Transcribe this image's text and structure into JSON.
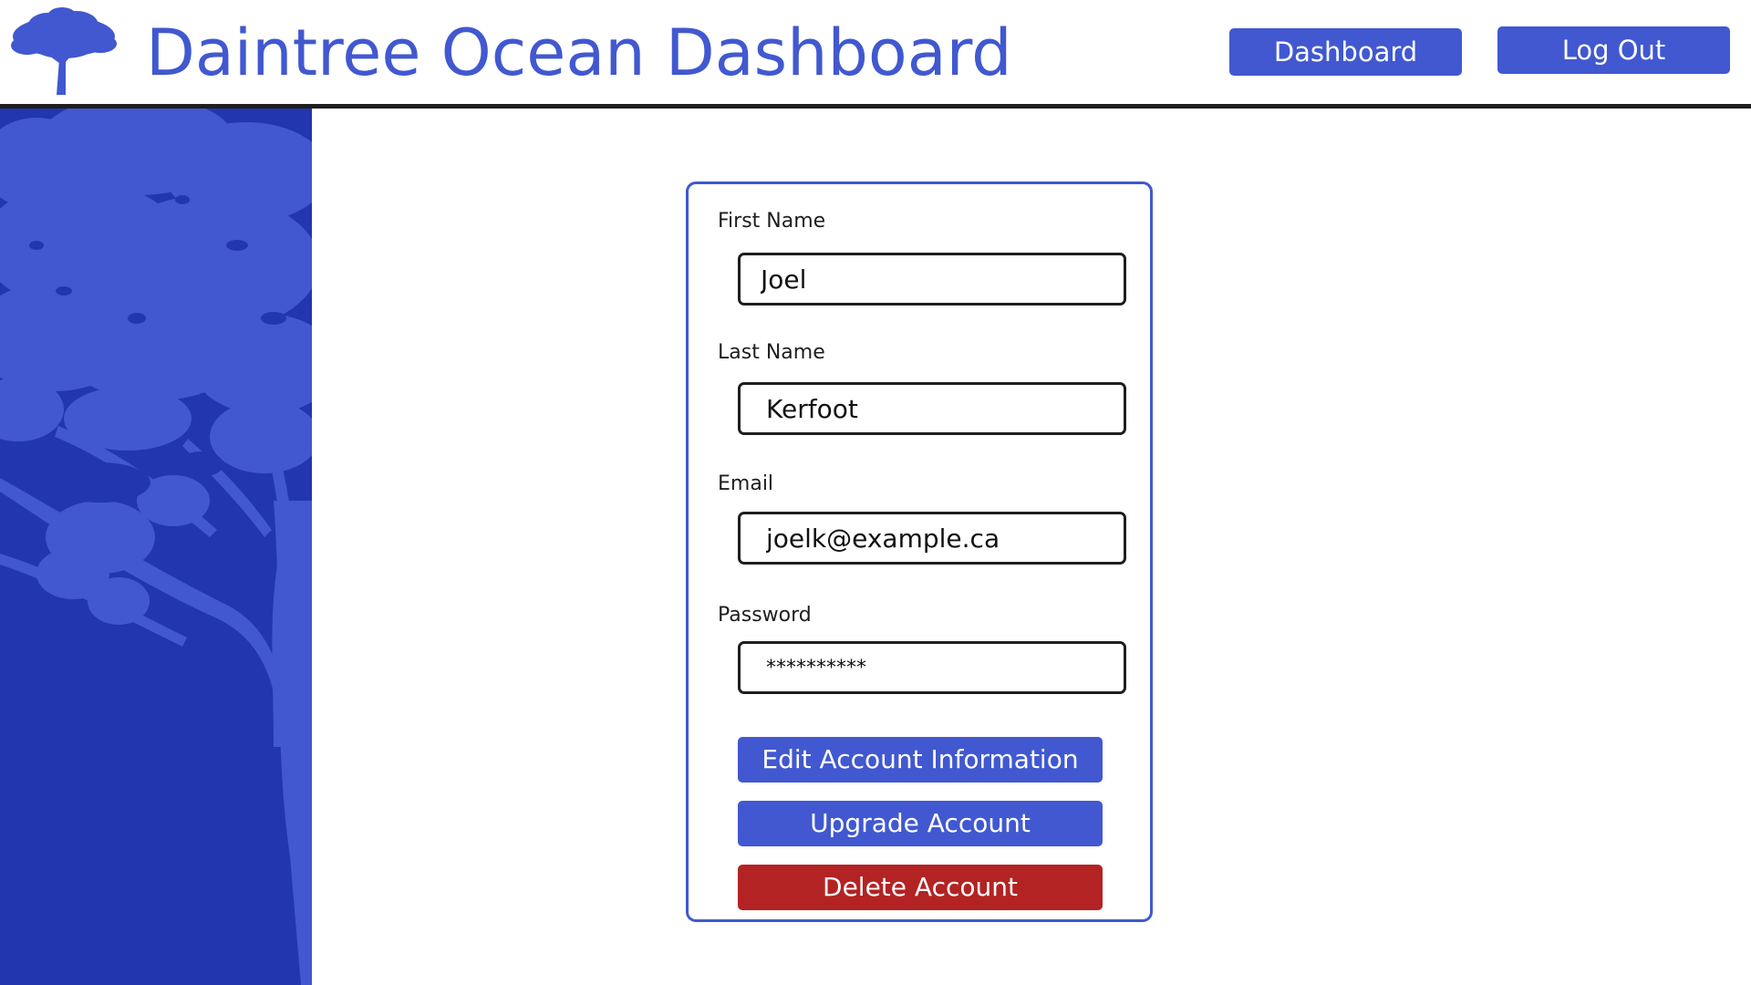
{
  "header": {
    "title": "Daintree Ocean Dashboard",
    "nav": {
      "dashboard_label": "Dashboard",
      "logout_label": "Log Out"
    }
  },
  "form": {
    "first_name": {
      "label": "First Name",
      "value": "Joel"
    },
    "last_name": {
      "label": "Last Name",
      "value": "Kerfoot"
    },
    "email": {
      "label": "Email",
      "value": "joelk@example.ca"
    },
    "password": {
      "label": "Password",
      "value": "**********"
    },
    "buttons": {
      "edit_label": "Edit Account Information",
      "upgrade_label": "Upgrade Account",
      "delete_label": "Delete Account"
    }
  },
  "colors": {
    "brand_blue": "#4158d0",
    "sidebar_blue": "#2236b0",
    "danger_red": "#b32323",
    "header_rule": "#1e1e1e"
  },
  "icons": {
    "logo": "tree-icon",
    "sidebar_art": "tree-silhouette"
  }
}
